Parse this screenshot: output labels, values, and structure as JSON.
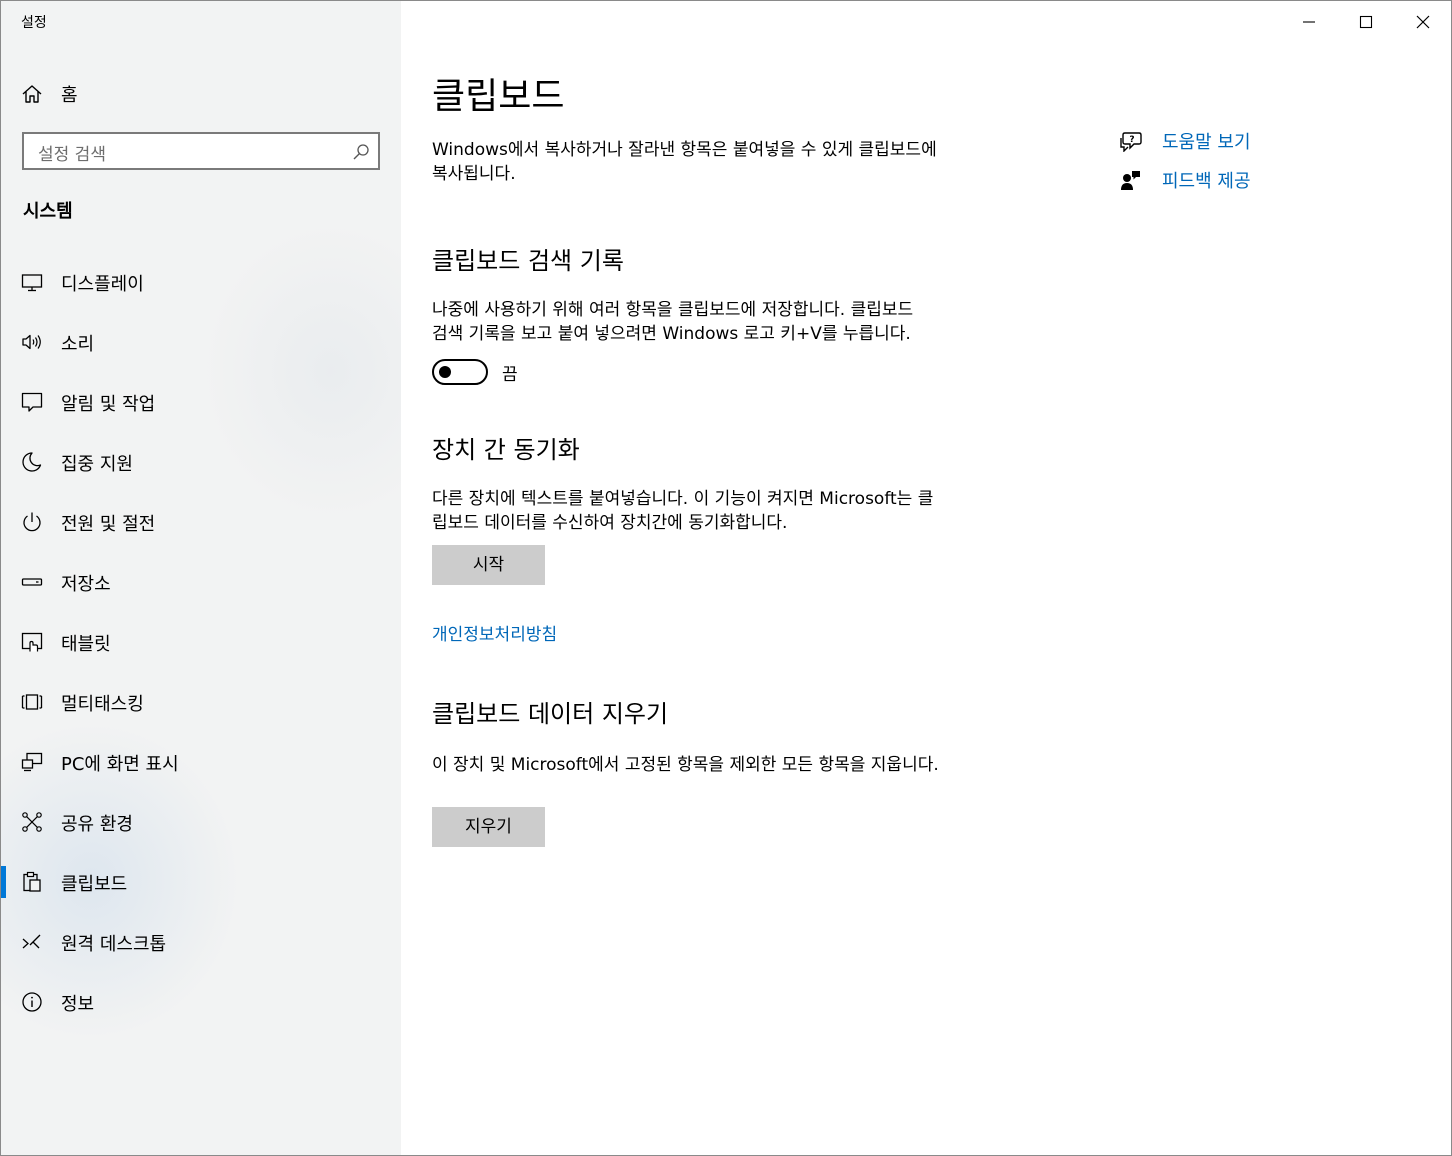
{
  "window": {
    "title": "설정",
    "controls": {
      "minimize": "minimize-icon",
      "maximize": "maximize-icon",
      "close": "close-icon"
    }
  },
  "sidebar": {
    "home_label": "홈",
    "search_placeholder": "설정 검색",
    "section_title": "시스템",
    "items": [
      {
        "label": "디스플레이",
        "icon": "display-icon"
      },
      {
        "label": "소리",
        "icon": "speaker-icon"
      },
      {
        "label": "알림 및 작업",
        "icon": "notification-icon"
      },
      {
        "label": "집중 지원",
        "icon": "moon-icon"
      },
      {
        "label": "전원 및 절전",
        "icon": "power-icon"
      },
      {
        "label": "저장소",
        "icon": "storage-icon"
      },
      {
        "label": "태블릿",
        "icon": "tablet-icon"
      },
      {
        "label": "멀티태스킹",
        "icon": "multitasking-icon"
      },
      {
        "label": "PC에 화면 표시",
        "icon": "project-icon"
      },
      {
        "label": "공유 환경",
        "icon": "share-icon"
      },
      {
        "label": "클립보드",
        "icon": "clipboard-icon",
        "active": true
      },
      {
        "label": "원격 데스크톱",
        "icon": "remote-desktop-icon"
      },
      {
        "label": "정보",
        "icon": "info-icon"
      }
    ],
    "accent_color": "#0078d7"
  },
  "main": {
    "title": "클립보드",
    "intro_line1": "Windows에서 복사하거나 잘라낸 항목은 붙여넣을 수 있게 클립보드에",
    "intro_line2": "복사됩니다.",
    "history": {
      "heading": "클립보드 검색 기록",
      "desc_line1": "나중에 사용하기 위해 여러 항목을 클립보드에 저장합니다. 클립보드",
      "desc_line2": "검색 기록을 보고 붙여 넣으려면 Windows 로고 키+V를 누릅니다.",
      "toggle_state": "끔"
    },
    "sync": {
      "heading": "장치 간 동기화",
      "desc_line1": "다른 장치에 텍스트를 붙여넣습니다. 이 기능이 켜지면 Microsoft는 클",
      "desc_line2": "립보드 데이터를 수신하여 장치간에 동기화합니다.",
      "button_label": "시작",
      "privacy_link": "개인정보처리방침"
    },
    "clear": {
      "heading": "클립보드 데이터 지우기",
      "desc": "이 장치 및 Microsoft에서 고정된 항목을 제외한 모든 항목을 지웁니다.",
      "button_label": "지우기"
    }
  },
  "help": {
    "get_help": "도움말 보기",
    "feedback": "피드백 제공",
    "link_color": "#0067b8"
  }
}
